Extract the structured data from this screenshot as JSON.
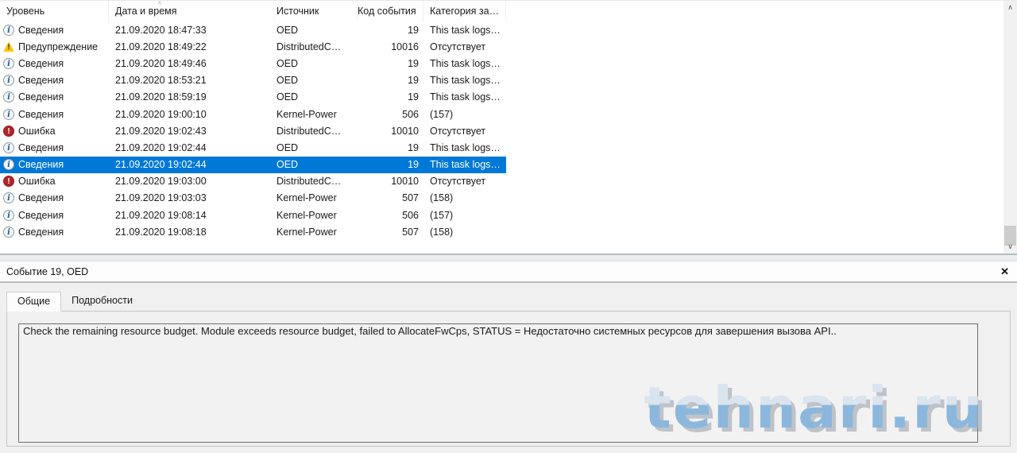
{
  "event_list": {
    "columns": [
      {
        "label": "Уровень"
      },
      {
        "label": "Дата и время"
      },
      {
        "label": "Источник"
      },
      {
        "label": "Код события"
      },
      {
        "label": "Категория за…"
      }
    ],
    "sort_caret": "∧",
    "rows": [
      {
        "icon": "info",
        "level": "Сведения",
        "datetime": "21.09.2020 18:47:33",
        "source": "OED",
        "event_id": "19",
        "category": "This task logs…",
        "selected": false
      },
      {
        "icon": "warning",
        "level": "Предупреждение",
        "datetime": "21.09.2020 18:49:22",
        "source": "DistributedC…",
        "event_id": "10016",
        "category": "Отсутствует",
        "selected": false
      },
      {
        "icon": "info",
        "level": "Сведения",
        "datetime": "21.09.2020 18:49:46",
        "source": "OED",
        "event_id": "19",
        "category": "This task logs…",
        "selected": false
      },
      {
        "icon": "info",
        "level": "Сведения",
        "datetime": "21.09.2020 18:53:21",
        "source": "OED",
        "event_id": "19",
        "category": "This task logs…",
        "selected": false
      },
      {
        "icon": "info",
        "level": "Сведения",
        "datetime": "21.09.2020 18:59:19",
        "source": "OED",
        "event_id": "19",
        "category": "This task logs…",
        "selected": false
      },
      {
        "icon": "info",
        "level": "Сведения",
        "datetime": "21.09.2020 19:00:10",
        "source": "Kernel-Power",
        "event_id": "506",
        "category": "(157)",
        "selected": false
      },
      {
        "icon": "error",
        "level": "Ошибка",
        "datetime": "21.09.2020 19:02:43",
        "source": "DistributedC…",
        "event_id": "10010",
        "category": "Отсутствует",
        "selected": false
      },
      {
        "icon": "info",
        "level": "Сведения",
        "datetime": "21.09.2020 19:02:44",
        "source": "OED",
        "event_id": "19",
        "category": "This task logs…",
        "selected": false
      },
      {
        "icon": "info",
        "level": "Сведения",
        "datetime": "21.09.2020 19:02:44",
        "source": "OED",
        "event_id": "19",
        "category": "This task logs…",
        "selected": true
      },
      {
        "icon": "error",
        "level": "Ошибка",
        "datetime": "21.09.2020 19:03:00",
        "source": "DistributedC…",
        "event_id": "10010",
        "category": "Отсутствует",
        "selected": false
      },
      {
        "icon": "info",
        "level": "Сведения",
        "datetime": "21.09.2020 19:03:03",
        "source": "Kernel-Power",
        "event_id": "507",
        "category": "(158)",
        "selected": false
      },
      {
        "icon": "info",
        "level": "Сведения",
        "datetime": "21.09.2020 19:08:14",
        "source": "Kernel-Power",
        "event_id": "506",
        "category": "(157)",
        "selected": false
      },
      {
        "icon": "info",
        "level": "Сведения",
        "datetime": "21.09.2020 19:08:18",
        "source": "Kernel-Power",
        "event_id": "507",
        "category": "(158)",
        "selected": false
      }
    ]
  },
  "scrollbar": {
    "up": "∧",
    "down": "∨"
  },
  "details": {
    "title": "Событие 19, OED",
    "close_label": "✕",
    "tabs": [
      {
        "label": "Общие",
        "active": true
      },
      {
        "label": "Подробности",
        "active": false
      }
    ],
    "message": "Check the remaining resource budget. Module exceeds resource budget, failed to AllocateFwCps, STATUS = Недостаточно системных ресурсов для завершения вызова API.."
  },
  "watermark": "tehnari.ru",
  "colors": {
    "selection_bg": "#0078d7",
    "selection_text": "#ffffff",
    "info_icon_blue": "#1f5d9e",
    "warning_yellow": "#fcc603",
    "error_red": "#b1252c",
    "watermark_blue": "#7fb0d9"
  }
}
